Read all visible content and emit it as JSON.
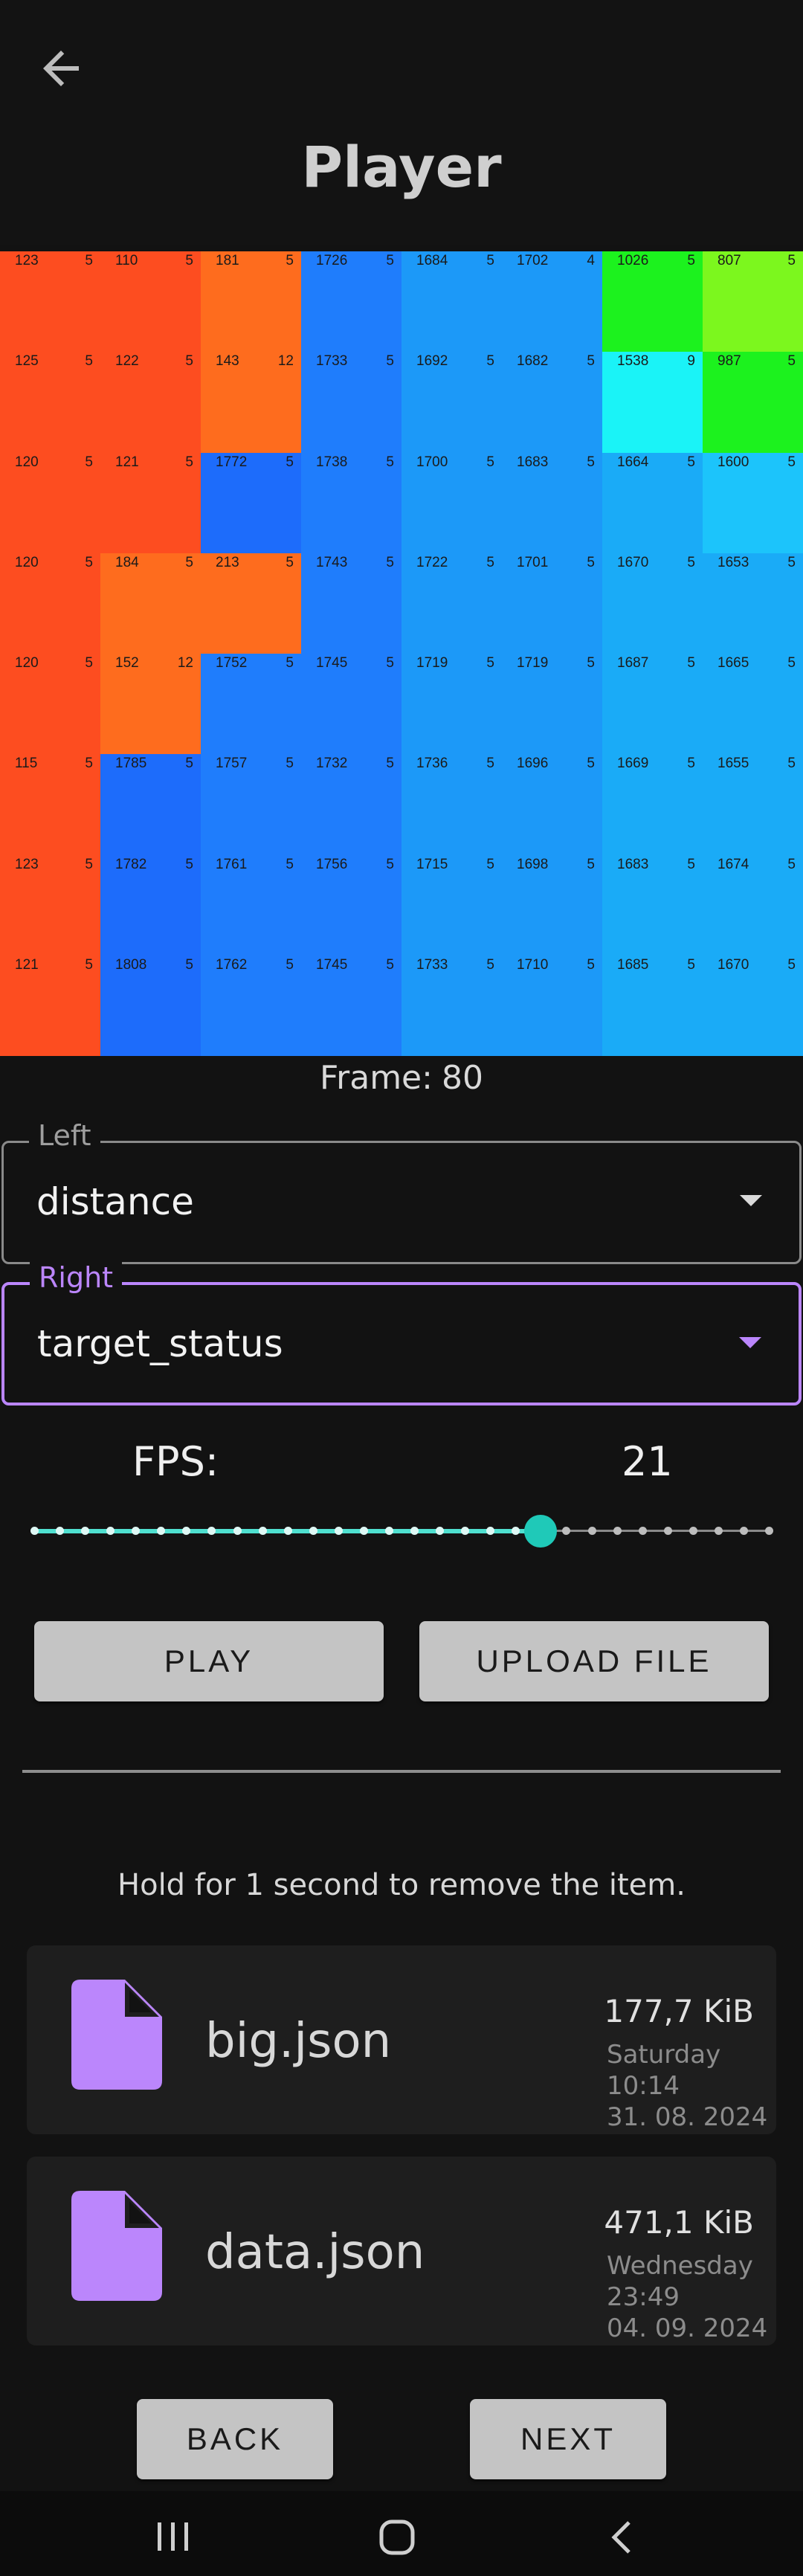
{
  "header": {
    "title": "Player",
    "back_icon": "arrow-left-icon"
  },
  "heatmap": {
    "colors": {
      "orangered": "#fd4d20",
      "orange": "#fe6c1e",
      "blue": "#1f7dfc",
      "blue_dark": "#1d6cfb",
      "sky": "#1c99f8",
      "sky_light": "#1aabf7",
      "cyan": "#1cc4fb",
      "aqua": "#1af3f7",
      "green": "#1cf21e",
      "lime": "#7cf71e"
    },
    "rows": [
      [
        {
          "v": "123",
          "s": "5",
          "c": "orangered"
        },
        {
          "v": "110",
          "s": "5",
          "c": "orangered"
        },
        {
          "v": "181",
          "s": "5",
          "c": "orange"
        },
        {
          "v": "1726",
          "s": "5",
          "c": "blue"
        },
        {
          "v": "1684",
          "s": "5",
          "c": "sky"
        },
        {
          "v": "1702",
          "s": "4",
          "c": "sky"
        },
        {
          "v": "1026",
          "s": "5",
          "c": "green"
        },
        {
          "v": "807",
          "s": "5",
          "c": "lime"
        }
      ],
      [
        {
          "v": "125",
          "s": "5",
          "c": "orangered"
        },
        {
          "v": "122",
          "s": "5",
          "c": "orangered"
        },
        {
          "v": "143",
          "s": "12",
          "c": "orange"
        },
        {
          "v": "1733",
          "s": "5",
          "c": "blue"
        },
        {
          "v": "1692",
          "s": "5",
          "c": "sky"
        },
        {
          "v": "1682",
          "s": "5",
          "c": "sky"
        },
        {
          "v": "1538",
          "s": "9",
          "c": "aqua"
        },
        {
          "v": "987",
          "s": "5",
          "c": "green"
        }
      ],
      [
        {
          "v": "120",
          "s": "5",
          "c": "orangered"
        },
        {
          "v": "121",
          "s": "5",
          "c": "orangered"
        },
        {
          "v": "1772",
          "s": "5",
          "c": "blue_dark"
        },
        {
          "v": "1738",
          "s": "5",
          "c": "blue"
        },
        {
          "v": "1700",
          "s": "5",
          "c": "sky"
        },
        {
          "v": "1683",
          "s": "5",
          "c": "sky"
        },
        {
          "v": "1664",
          "s": "5",
          "c": "sky_light"
        },
        {
          "v": "1600",
          "s": "5",
          "c": "cyan"
        }
      ],
      [
        {
          "v": "120",
          "s": "5",
          "c": "orangered"
        },
        {
          "v": "184",
          "s": "5",
          "c": "orange"
        },
        {
          "v": "213",
          "s": "5",
          "c": "orange"
        },
        {
          "v": "1743",
          "s": "5",
          "c": "blue"
        },
        {
          "v": "1722",
          "s": "5",
          "c": "sky"
        },
        {
          "v": "1701",
          "s": "5",
          "c": "sky"
        },
        {
          "v": "1670",
          "s": "5",
          "c": "sky_light"
        },
        {
          "v": "1653",
          "s": "5",
          "c": "sky_light"
        }
      ],
      [
        {
          "v": "120",
          "s": "5",
          "c": "orangered"
        },
        {
          "v": "152",
          "s": "12",
          "c": "orange"
        },
        {
          "v": "1752",
          "s": "5",
          "c": "blue"
        },
        {
          "v": "1745",
          "s": "5",
          "c": "blue"
        },
        {
          "v": "1719",
          "s": "5",
          "c": "sky"
        },
        {
          "v": "1719",
          "s": "5",
          "c": "sky"
        },
        {
          "v": "1687",
          "s": "5",
          "c": "sky_light"
        },
        {
          "v": "1665",
          "s": "5",
          "c": "sky_light"
        }
      ],
      [
        {
          "v": "115",
          "s": "5",
          "c": "orangered"
        },
        {
          "v": "1785",
          "s": "5",
          "c": "blue_dark"
        },
        {
          "v": "1757",
          "s": "5",
          "c": "blue"
        },
        {
          "v": "1732",
          "s": "5",
          "c": "blue"
        },
        {
          "v": "1736",
          "s": "5",
          "c": "sky"
        },
        {
          "v": "1696",
          "s": "5",
          "c": "sky"
        },
        {
          "v": "1669",
          "s": "5",
          "c": "sky_light"
        },
        {
          "v": "1655",
          "s": "5",
          "c": "sky_light"
        }
      ],
      [
        {
          "v": "123",
          "s": "5",
          "c": "orangered"
        },
        {
          "v": "1782",
          "s": "5",
          "c": "blue_dark"
        },
        {
          "v": "1761",
          "s": "5",
          "c": "blue"
        },
        {
          "v": "1756",
          "s": "5",
          "c": "blue"
        },
        {
          "v": "1715",
          "s": "5",
          "c": "sky"
        },
        {
          "v": "1698",
          "s": "5",
          "c": "sky"
        },
        {
          "v": "1683",
          "s": "5",
          "c": "sky_light"
        },
        {
          "v": "1674",
          "s": "5",
          "c": "sky_light"
        }
      ],
      [
        {
          "v": "121",
          "s": "5",
          "c": "orangered"
        },
        {
          "v": "1808",
          "s": "5",
          "c": "blue_dark"
        },
        {
          "v": "1762",
          "s": "5",
          "c": "blue"
        },
        {
          "v": "1745",
          "s": "5",
          "c": "blue"
        },
        {
          "v": "1733",
          "s": "5",
          "c": "sky"
        },
        {
          "v": "1710",
          "s": "5",
          "c": "sky"
        },
        {
          "v": "1685",
          "s": "5",
          "c": "sky_light"
        },
        {
          "v": "1670",
          "s": "5",
          "c": "sky_light"
        }
      ]
    ]
  },
  "frame": {
    "label": "Frame:",
    "value": "80"
  },
  "left_select": {
    "legend": "Left",
    "value": "distance",
    "icon": "dropdown-caret-icon"
  },
  "right_select": {
    "legend": "Right",
    "value": "target_status",
    "icon": "dropdown-caret-icon",
    "accent": "#bb86fc"
  },
  "fps": {
    "label": "FPS:",
    "value": "21",
    "min": 1,
    "max": 30,
    "accent": "#1fc9b8"
  },
  "buttons": {
    "play": "PLAY",
    "upload": "UPLOAD FILE",
    "back": "BACK",
    "next": "NEXT"
  },
  "hint": "Hold for 1 second to remove the item.",
  "files": [
    {
      "name": "big.json",
      "size": "177,7 KiB",
      "day": "Saturday",
      "time": "10:14",
      "date": "31. 08. 2024",
      "icon": "file-icon"
    },
    {
      "name": "data.json",
      "size": "471,1 KiB",
      "day": "Wednesday",
      "time": "23:49",
      "date": "04. 09. 2024",
      "icon": "file-icon"
    }
  ],
  "navbar": {
    "icons": [
      "recent-apps-icon",
      "home-icon",
      "back-nav-icon"
    ]
  }
}
